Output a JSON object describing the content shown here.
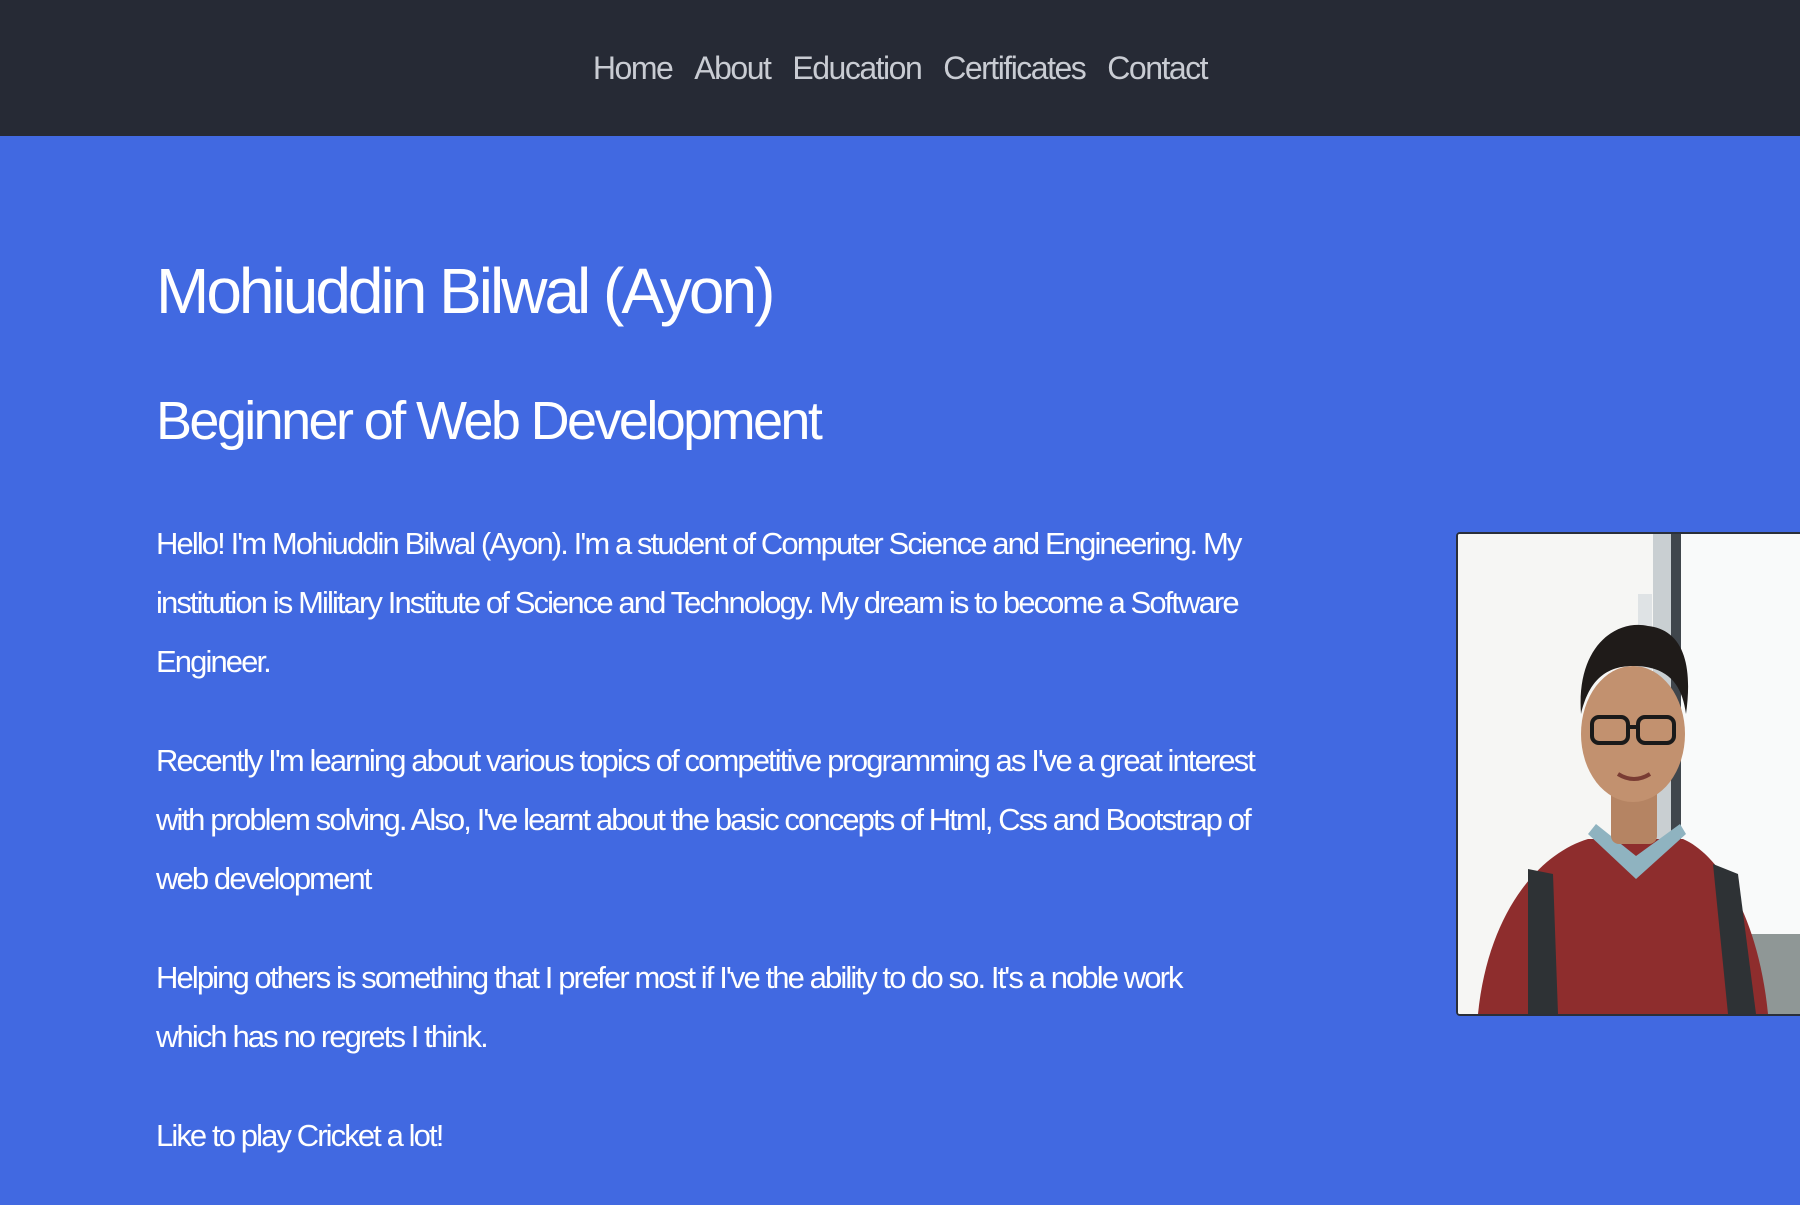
{
  "nav": {
    "items": [
      {
        "label": "Home"
      },
      {
        "label": "About"
      },
      {
        "label": "Education"
      },
      {
        "label": "Certificates"
      },
      {
        "label": "Contact"
      }
    ]
  },
  "hero": {
    "name": "Mohiuddin Bilwal (Ayon)",
    "subtitle": "Beginner of Web Development",
    "paragraphs": [
      "Hello! I'm Mohiuddin Bilwal (Ayon). I'm a student of Computer Science and Engineering. My institution is Military Institute of Science and Technology. My dream is to become a Software Engineer.",
      "Recently I'm learning about various topics of competitive programming as I've a great interest with problem solving. Also, I've learnt about the basic concepts of Html, Css and Bootstrap of web development",
      "Helping others is something that I prefer most if I've the ability to do so. It's a noble work which has no regrets I think.",
      "Like to play Cricket a lot!"
    ]
  },
  "photo": {
    "icon": "profile-photo"
  },
  "colors": {
    "navbar_bg": "#262a35",
    "page_bg": "#4169e1",
    "nav_text": "#c9ccd3",
    "text": "#ffffff"
  }
}
